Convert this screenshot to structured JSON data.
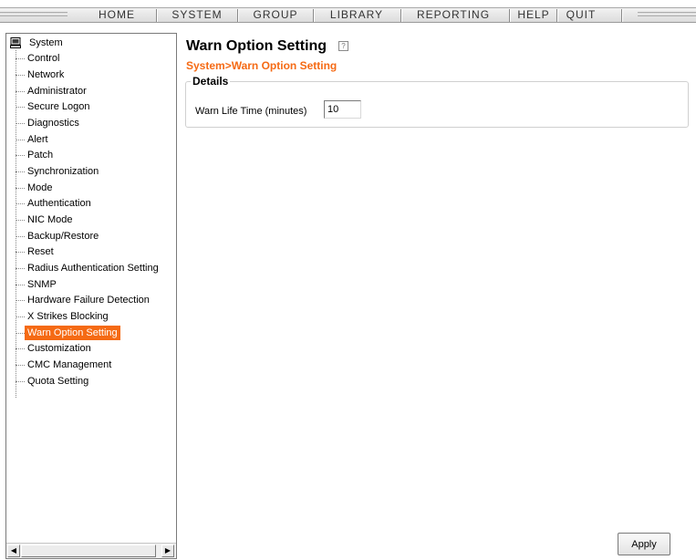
{
  "menu": {
    "items": [
      "HOME",
      "SYSTEM",
      "GROUP",
      "LIBRARY",
      "REPORTING",
      "HELP",
      "QUIT"
    ]
  },
  "sidebar": {
    "root": {
      "label": "System",
      "icon": "computer-icon"
    },
    "items": [
      {
        "label": "Control"
      },
      {
        "label": "Network"
      },
      {
        "label": "Administrator"
      },
      {
        "label": "Secure Logon"
      },
      {
        "label": "Diagnostics"
      },
      {
        "label": "Alert"
      },
      {
        "label": "Patch"
      },
      {
        "label": "Synchronization"
      },
      {
        "label": "Mode"
      },
      {
        "label": "Authentication"
      },
      {
        "label": "NIC Mode"
      },
      {
        "label": "Backup/Restore"
      },
      {
        "label": "Reset"
      },
      {
        "label": "Radius Authentication Setting"
      },
      {
        "label": "SNMP"
      },
      {
        "label": "Hardware Failure Detection"
      },
      {
        "label": "X Strikes Blocking"
      },
      {
        "label": "Warn Option Setting",
        "selected": true
      },
      {
        "label": "Customization"
      },
      {
        "label": "CMC Management"
      },
      {
        "label": "Quota Setting"
      }
    ],
    "scroll_left_icon": "left-arrow-icon",
    "scroll_right_icon": "right-arrow-icon"
  },
  "main": {
    "title": "Warn Option Setting",
    "breadcrumb": "System>Warn Option Setting",
    "details": {
      "legend": "Details",
      "warn_life_time_label": "Warn Life Time (minutes)",
      "warn_life_time_value": "10"
    },
    "apply_label": "Apply"
  },
  "colors": {
    "accent": "#f56a14",
    "selected_text": "#ffffff"
  }
}
